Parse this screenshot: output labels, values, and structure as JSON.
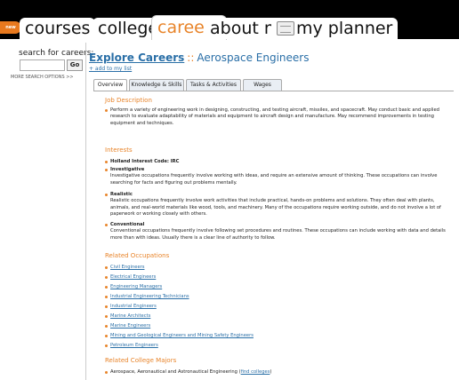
{
  "nav": {
    "new_badge": "new",
    "tabs": [
      {
        "label": "courses",
        "active": false
      },
      {
        "label": "colleges",
        "active": false
      },
      {
        "label": "careers",
        "active": true
      },
      {
        "label": "about me",
        "active": false
      },
      {
        "label": "my planner",
        "active": false
      }
    ]
  },
  "sidebar": {
    "search_label": "search for careers:",
    "search_value": "",
    "go_label": "Go",
    "more_options": "MORE SEARCH OPTIONS >>"
  },
  "header": {
    "breadcrumb": "Explore Careers",
    "separator": "::",
    "occupation": "Aerospace Engineers",
    "add_to_list": "+ add to my list"
  },
  "subtabs": [
    {
      "label": "Overview",
      "active": true
    },
    {
      "label": "Knowledge & Skills",
      "active": false
    },
    {
      "label": "Tasks & Activities",
      "active": false
    },
    {
      "label": "Wages",
      "active": false
    }
  ],
  "job_description": {
    "heading": "Job Description",
    "text": "Perform a variety of engineering work in designing, constructing, and testing aircraft, missiles, and spacecraft. May conduct basic and applied research to evaluate adaptability of materials and equipment to aircraft design and manufacture. May recommend improvements in testing equipment and techniques."
  },
  "interests": {
    "heading": "Interests",
    "code": "Holland Interest Code: IRC",
    "items": [
      {
        "title": "Investigative",
        "text": "Investigative occupations frequently involve working with ideas, and require an extensive amount of thinking. These occupations can involve searching for facts and figuring out problems mentally."
      },
      {
        "title": "Realistic",
        "text": "Realistic occupations frequently involve work activities that include practical, hands-on problems and solutions. They often deal with plants, animals, and real-world materials like wood, tools, and machinery. Many of the occupations require working outside, and do not involve a lot of paperwork or working closely with others."
      },
      {
        "title": "Conventional",
        "text": "Conventional occupations frequently involve following set procedures and routines. These occupations can include working with data and details more than with ideas. Usually there is a clear line of authority to follow."
      }
    ]
  },
  "related_occupations": {
    "heading": "Related Occupations",
    "items": [
      "Civil Engineers",
      "Electrical Engineers",
      "Engineering Managers",
      "Industrial Engineering Technicians",
      "Industrial Engineers",
      "Marine Architects",
      "Marine Engineers",
      "Mining and Geological Engineers and Mining Safety Engineers",
      "Petroleum Engineers"
    ]
  },
  "related_majors": {
    "heading": "Related College Majors",
    "item": "Aerospace, Aeronautical and Astronautical Engineering",
    "find_link": "find colleges"
  },
  "colors": {
    "accent": "#e8842a",
    "link": "#2a6fa7"
  }
}
